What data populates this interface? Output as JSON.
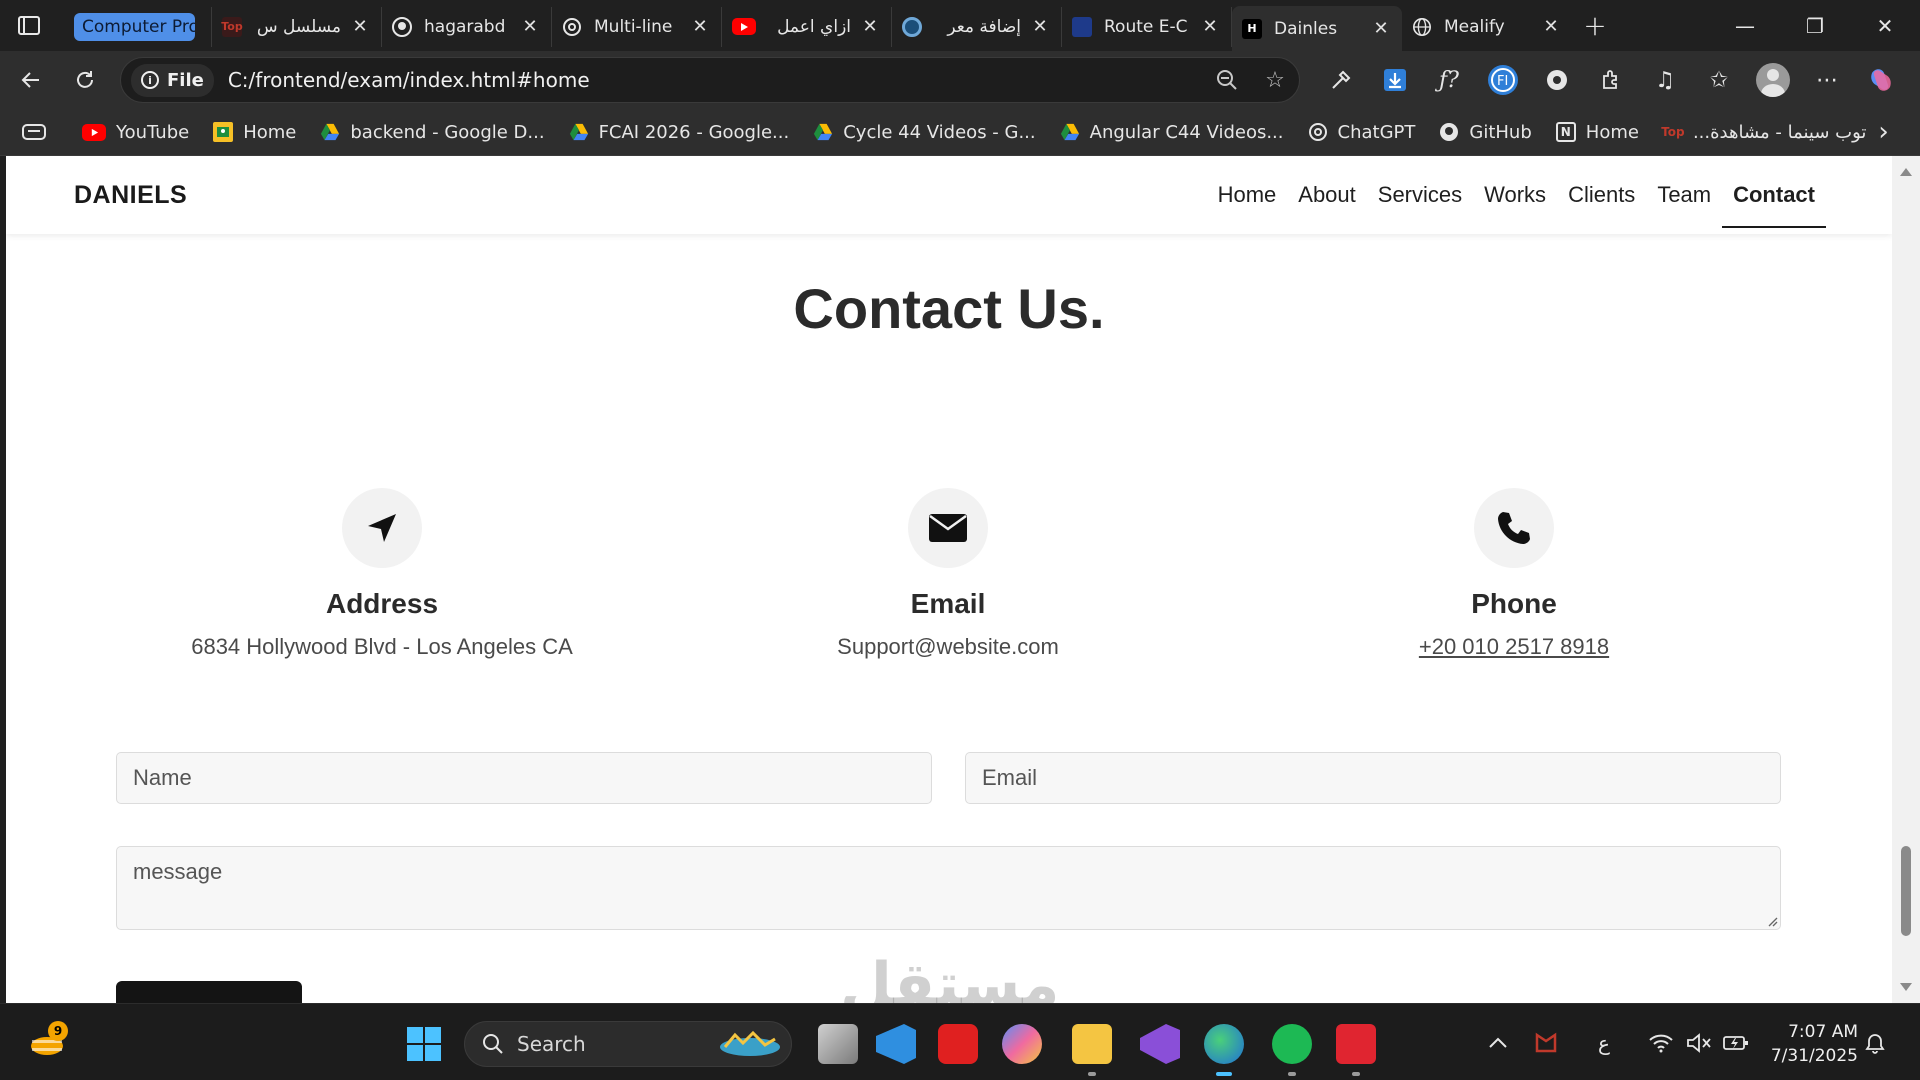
{
  "browser": {
    "tab_group_label": "Computer Progr",
    "tabs": [
      {
        "title": "مسلسل س",
        "favicon": "topcinema-icon"
      },
      {
        "title": "hagarabd",
        "favicon": "github-icon"
      },
      {
        "title": "Multi-line",
        "favicon": "chatgpt-icon"
      },
      {
        "title": "ازاي اعمل",
        "favicon": "youtube-icon"
      },
      {
        "title": "إضافة معر",
        "favicon": "circle-icon"
      },
      {
        "title": "Route E-C",
        "favicon": "route-icon"
      },
      {
        "title": "Dainles",
        "favicon": "bootstrap-icon",
        "active": true
      },
      {
        "title": "Mealify",
        "favicon": "globe-icon"
      }
    ],
    "site_info_label": "File",
    "url": "C:/frontend/exam/index.html#home",
    "bookmarks": [
      {
        "label": "YouTube",
        "icon": "youtube-icon"
      },
      {
        "label": "Home",
        "icon": "classroom-icon"
      },
      {
        "label": "backend - Google D...",
        "icon": "drive-icon"
      },
      {
        "label": "FCAI 2026 - Google...",
        "icon": "drive-icon"
      },
      {
        "label": "Cycle 44 Videos - G...",
        "icon": "drive-icon"
      },
      {
        "label": "Angular C44 Videos...",
        "icon": "drive-icon"
      },
      {
        "label": "ChatGPT",
        "icon": "chatgpt-icon"
      },
      {
        "label": "GitHub",
        "icon": "github-icon"
      },
      {
        "label": "Home",
        "icon": "notion-icon"
      },
      {
        "label": "توب سينما - مشاهدة...",
        "icon": "topcinema-icon"
      }
    ]
  },
  "site": {
    "brand": "DANIELS",
    "nav": [
      {
        "label": "Home",
        "active": false
      },
      {
        "label": "About",
        "active": false
      },
      {
        "label": "Services",
        "active": false
      },
      {
        "label": "Works",
        "active": false
      },
      {
        "label": "Clients",
        "active": false
      },
      {
        "label": "Team",
        "active": false
      },
      {
        "label": "Contact",
        "active": true
      }
    ],
    "contact": {
      "title": "Contact Us.",
      "address_label": "Address",
      "address_value": "6834 Hollywood Blvd - Los Angeles CA",
      "email_label": "Email",
      "email_value": "Support@website.com",
      "phone_label": "Phone",
      "phone_value": "+20 010 2517 8918",
      "form": {
        "name_placeholder": "Name",
        "email_placeholder": "Email",
        "message_placeholder": "message"
      }
    }
  },
  "taskbar": {
    "widget_badge": "9",
    "search_label": "Search",
    "ime_indicator": "ع",
    "time": "7:07 AM",
    "date": "7/31/2025"
  },
  "watermark": "مستقل",
  "colors": {
    "accent": "#4f8fe8",
    "dark": "#141414",
    "nav_text": "#1f1f1f"
  }
}
